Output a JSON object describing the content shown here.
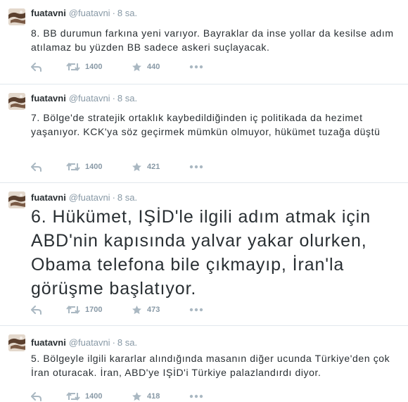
{
  "tweets": [
    {
      "name": "fuatavni",
      "handle": "@fuatavni",
      "separator": "·",
      "time": "8 sa.",
      "text": "8. BB durumun farkına yeni varıyor. Bayraklar da inse yollar da kesilse adım atılamaz bu yüzden BB sadece askeri suçlayacak.",
      "retweets": "1400",
      "favorites": "440",
      "icons": {
        "reply": "reply-icon",
        "retweet": "retweet-icon",
        "favorite": "star-icon",
        "more": "more-icon"
      }
    },
    {
      "name": "fuatavni",
      "handle": "@fuatavni",
      "separator": "·",
      "time": "8 sa.",
      "text": "7. Bölge'de stratejik ortaklık kaybedildiğinden iç politikada da hezimet yaşanıyor. KCK'ya söz geçirmek mümkün olmuyor, hükümet tuzağa düştü",
      "retweets": "1400",
      "favorites": "421",
      "icons": {
        "reply": "reply-icon",
        "retweet": "retweet-icon",
        "favorite": "star-icon",
        "more": "more-icon"
      }
    },
    {
      "name": "fuatavni",
      "handle": "@fuatavni",
      "separator": "·",
      "time": "8 sa.",
      "text": "6. Hükümet, IŞİD'le ilgili adım atmak için ABD'nin kapısında yalvar yakar olurken, Obama telefona bile çıkmayıp, İran'la görüşme başlatıyor.",
      "retweets": "1700",
      "favorites": "473",
      "icons": {
        "reply": "reply-icon",
        "retweet": "retweet-icon",
        "favorite": "star-icon",
        "more": "more-icon"
      }
    },
    {
      "name": "fuatavni",
      "handle": "@fuatavni",
      "separator": "·",
      "time": "8 sa.",
      "text": "5. Bölgeyle ilgili kararlar alındığında masanın diğer ucunda Türkiye'den çok İran oturacak. İran, ABD'ye IŞİD'i Türkiye palazlandırdı diyor.",
      "retweets": "1400",
      "favorites": "418",
      "icons": {
        "reply": "reply-icon",
        "retweet": "retweet-icon",
        "favorite": "star-icon",
        "more": "more-icon"
      }
    }
  ],
  "colors": {
    "text": "#292f33",
    "meta": "#8899a6",
    "divider": "#e1e8ed",
    "background": "#ffffff"
  }
}
